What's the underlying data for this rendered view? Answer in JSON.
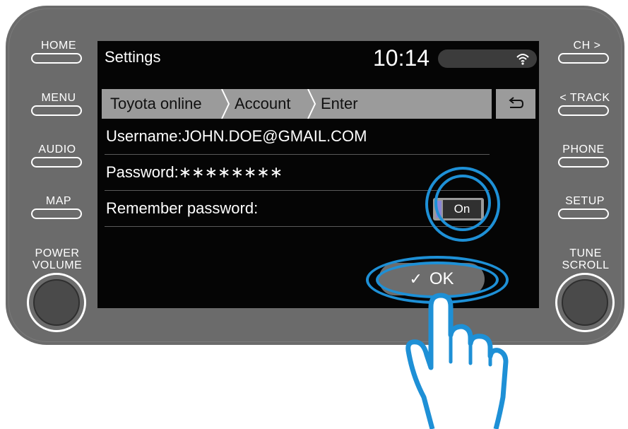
{
  "hardware": {
    "left_buttons": [
      {
        "label": "HOME",
        "icon": "home-button"
      },
      {
        "label": "MENU",
        "icon": "menu-button"
      },
      {
        "label": "AUDIO",
        "icon": "audio-button"
      },
      {
        "label": "MAP",
        "icon": "map-button"
      }
    ],
    "right_buttons": [
      {
        "label": "CH >",
        "icon": "channel-button"
      },
      {
        "label": "< TRACK",
        "icon": "track-button"
      },
      {
        "label": "PHONE",
        "icon": "phone-button"
      },
      {
        "label": "SETUP",
        "icon": "setup-button"
      }
    ],
    "left_knob_label_1": "POWER",
    "left_knob_label_2": "VOLUME",
    "right_knob_label_1": "TUNE",
    "right_knob_label_2": "SCROLL"
  },
  "screen": {
    "title": "Settings",
    "clock": "10:14",
    "breadcrumb": [
      "Toyota online",
      "Account",
      "Enter"
    ],
    "rows": {
      "username": "Username:JOHN.DOE@GMAIL.COM",
      "password": "Password:∗∗∗∗∗∗∗∗",
      "remember": "Remember password:"
    },
    "toggle_label": "On",
    "ok_label": "OK"
  },
  "colors": {
    "bezel": "#6b6b6b",
    "screen": "#050505",
    "highlight": "#1e90d6",
    "toggle_indicator": "#8a86d6"
  }
}
